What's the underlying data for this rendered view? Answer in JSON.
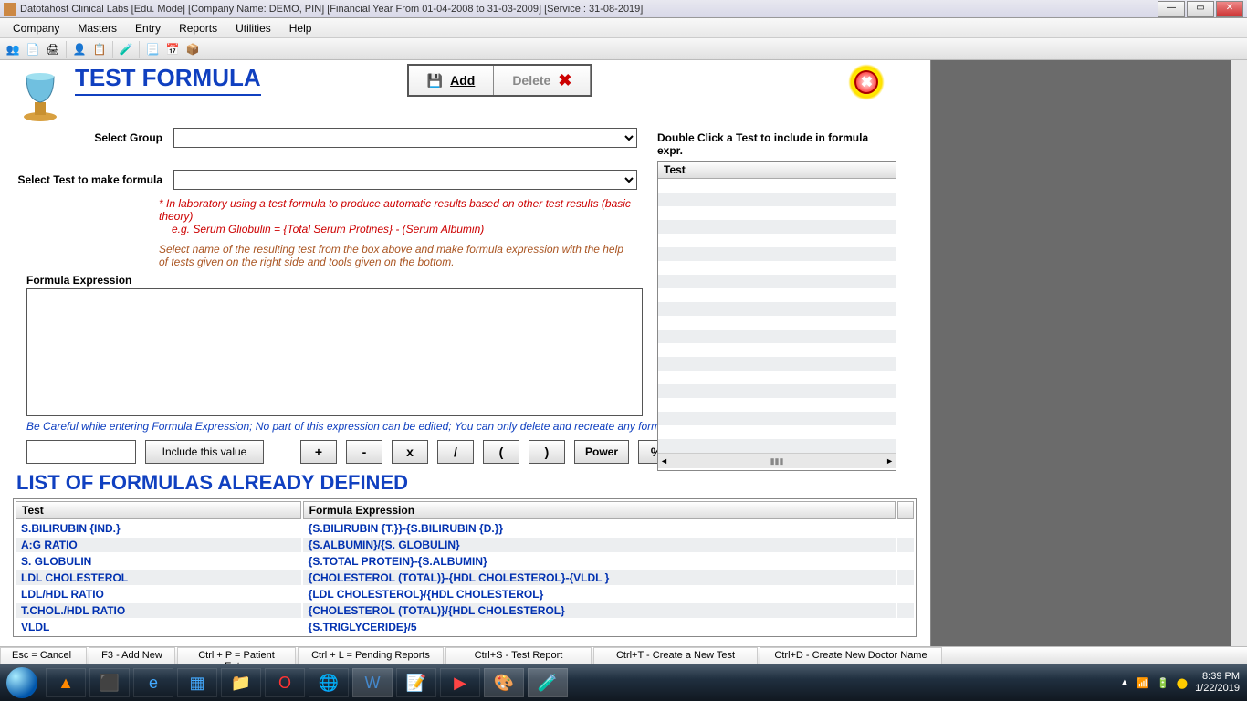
{
  "window": {
    "title": "Datotahost Clinical Labs [Edu. Mode] [Company Name: DEMO, PIN] [Financial Year From 01-04-2008 to 31-03-2009]  [Service : 31-08-2019]"
  },
  "menubar": [
    "Company",
    "Masters",
    "Entry",
    "Reports",
    "Utilities",
    "Help"
  ],
  "page": {
    "title": "TEST FORMULA",
    "add_label": "Add",
    "delete_label": "Delete",
    "select_group_label": "Select Group",
    "select_test_label": "Select Test to make formula",
    "hint1": "* In laboratory using a test formula to produce automatic results based on other test results (basic theory)",
    "hint2": "e.g. Serum Gliobulin = {Total Serum Protines} - (Serum Albumin)",
    "hint3": "Select name of the resulting test from the box above and make formula expression with the help of tests given on the right side and tools given on the bottom.",
    "formula_label": "Formula Expression",
    "careful_text": "Be Careful while entering Formula Expression; No part of this expression can be edited;  You can only delete and recreate any formula",
    "include_btn": "Include this value",
    "ops": {
      "plus": "+",
      "minus": "-",
      "mult": "x",
      "div": "/",
      "lparen": "(",
      "rparen": ")",
      "power": "Power",
      "pct": "%"
    },
    "test_panel_label": "Double Click a Test to include in formula expr.",
    "test_column": "Test",
    "list_title": "LIST OF FORMULAS ALREADY DEFINED",
    "table_headers": {
      "test": "Test",
      "expr": "Formula Expression"
    },
    "formulas": [
      {
        "test": "S.BILIRUBIN {IND.}",
        "expr": "{S.BILIRUBIN {T.}}-{S.BILIRUBIN {D.}}"
      },
      {
        "test": "A:G RATIO",
        "expr": "{S.ALBUMIN}/{S. GLOBULIN}"
      },
      {
        "test": "S. GLOBULIN",
        "expr": "{S.TOTAL PROTEIN}-{S.ALBUMIN}"
      },
      {
        "test": "LDL CHOLESTEROL",
        "expr": "{CHOLESTEROL (TOTAL)}-{HDL CHOLESTEROL}-{VLDL }"
      },
      {
        "test": "LDL/HDL RATIO",
        "expr": "{LDL CHOLESTEROL}/{HDL CHOLESTEROL}"
      },
      {
        "test": "T.CHOL./HDL RATIO",
        "expr": "{CHOLESTEROL (TOTAL)}/{HDL CHOLESTEROL}"
      },
      {
        "test": "VLDL",
        "expr": "{S.TRIGLYCERIDE}/5"
      }
    ]
  },
  "statusbar": [
    "Esc = Cancel",
    "F3 - Add New",
    "Ctrl + P = Patient Entry",
    "Ctrl + L = Pending Reports",
    "Ctrl+S - Test Report",
    "Ctrl+T -  Create a New Test",
    "Ctrl+D - Create New Doctor Name"
  ],
  "tray": {
    "time": "8:39 PM",
    "date": "1/22/2019"
  }
}
